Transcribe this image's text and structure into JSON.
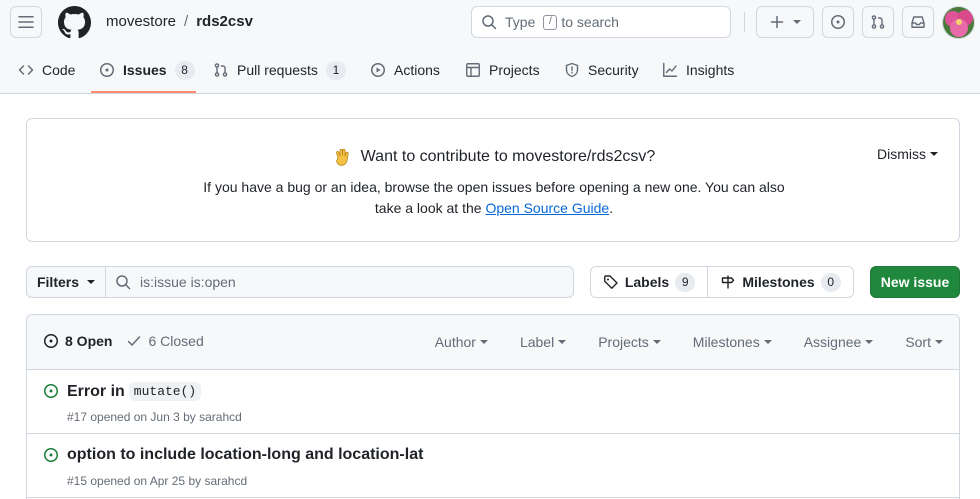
{
  "header": {
    "owner": "movestore",
    "separator": "/",
    "repo": "rds2csv",
    "search": {
      "prefix": "Type",
      "key": "/",
      "suffix": "to search"
    }
  },
  "nav": {
    "tabs": [
      {
        "label": "Code",
        "icon": "code-icon"
      },
      {
        "label": "Issues",
        "icon": "issue-opened-icon",
        "count": "8",
        "active": true
      },
      {
        "label": "Pull requests",
        "icon": "git-pull-request-icon",
        "count": "1"
      },
      {
        "label": "Actions",
        "icon": "play-icon"
      },
      {
        "label": "Projects",
        "icon": "table-icon"
      },
      {
        "label": "Security",
        "icon": "shield-icon"
      },
      {
        "label": "Insights",
        "icon": "graph-icon"
      }
    ]
  },
  "banner": {
    "title": "Want to contribute to movestore/rds2csv?",
    "text_before_link": "If you have a bug or an idea, browse the open issues before opening a new one. You can also take a look at the",
    "link_text": "Open Source Guide",
    "text_after_link": ".",
    "dismiss_label": "Dismiss"
  },
  "filters": {
    "filters_label": "Filters",
    "query": "is:issue is:open",
    "labels_label": "Labels",
    "labels_count": "9",
    "milestones_label": "Milestones",
    "milestones_count": "0",
    "new_issue_label": "New issue"
  },
  "issues_list": {
    "open_label": "8 Open",
    "closed_label": "6 Closed",
    "sort_buttons": [
      "Author",
      "Label",
      "Projects",
      "Milestones",
      "Assignee",
      "Sort"
    ],
    "issues": [
      {
        "title_text": "Error in",
        "title_code": "mutate()",
        "meta": "#17 opened on Jun 3 by sarahcd"
      },
      {
        "title_text": "option to include location-long and location-lat",
        "title_code": "",
        "meta": "#15 opened on Apr 25 by sarahcd"
      }
    ]
  },
  "colors": {
    "accent_green": "#1f883d",
    "open_icon_green": "#1a7f37",
    "link_blue": "#0969da",
    "tab_underline": "#fd8c73"
  }
}
